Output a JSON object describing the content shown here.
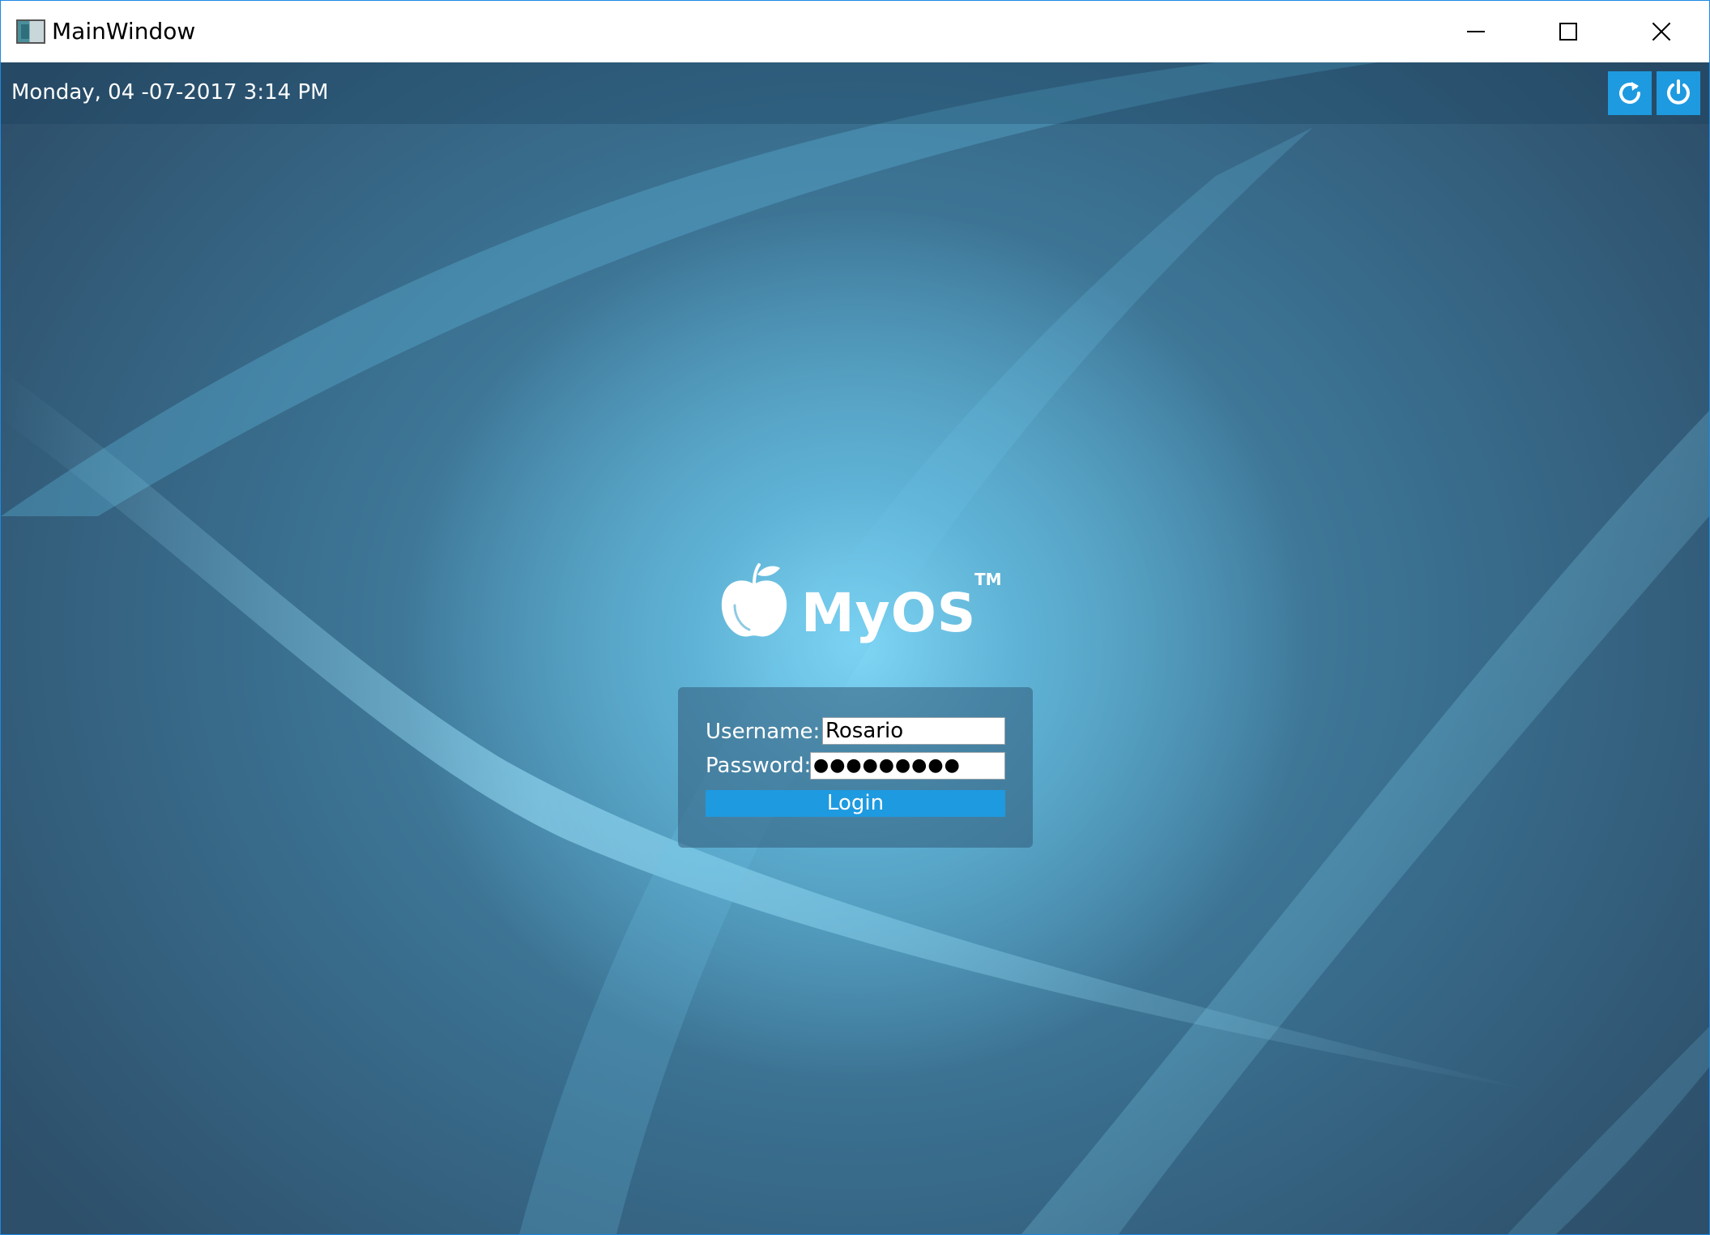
{
  "window": {
    "title": "MainWindow",
    "controls": {
      "minimize": "minimize-icon",
      "maximize": "maximize-icon",
      "close": "close-icon"
    }
  },
  "topbar": {
    "datetime": "Monday, 04 -07-2017 3:14 PM",
    "buttons": [
      {
        "name": "restart",
        "icon": "restart-icon"
      },
      {
        "name": "power",
        "icon": "power-icon"
      }
    ],
    "accent": "#1e9ae0"
  },
  "logo": {
    "icon": "apple-icon",
    "text": "MyOS",
    "trademark": "TM"
  },
  "login": {
    "username_label": "Username:",
    "username_value": "Rosario",
    "password_label": "Password:",
    "password_value": "●●●●●●●●●",
    "button_label": "Login"
  },
  "colors": {
    "background_dark": "#2d4f6a",
    "background_glow": "#7fd6f5",
    "button": "#1e9ae0"
  }
}
